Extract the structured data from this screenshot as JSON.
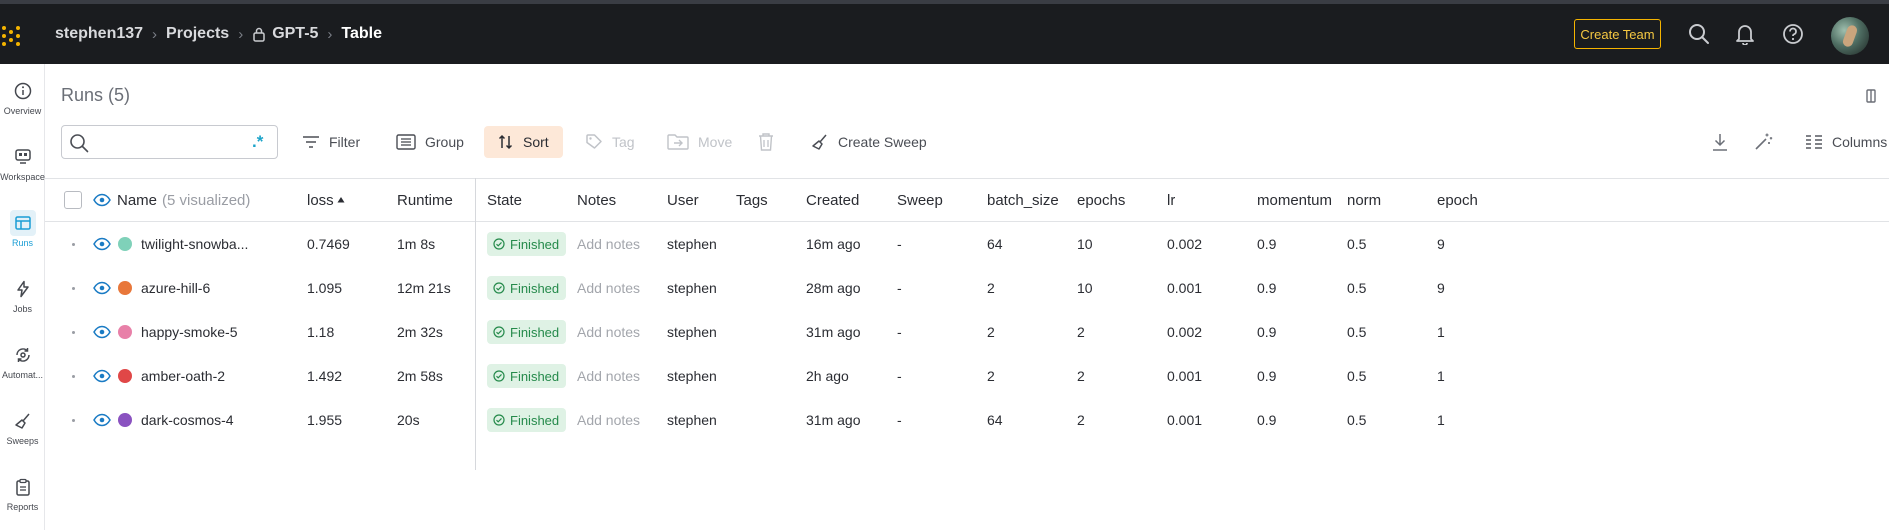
{
  "breadcrumb": {
    "user": "stephen137",
    "projects": "Projects",
    "project": "GPT-5",
    "current": "Table"
  },
  "header": {
    "create_team": "Create Team",
    "icons": [
      "search-icon",
      "bell-icon",
      "help-icon",
      "avatar"
    ]
  },
  "sidebar": {
    "items": [
      {
        "label": "Overview",
        "icon": "info-icon"
      },
      {
        "label": "Workspace",
        "icon": "workspace-icon"
      },
      {
        "label": "Runs",
        "icon": "table-icon",
        "active": true
      },
      {
        "label": "Jobs",
        "icon": "lightning-icon"
      },
      {
        "label": "Automat...",
        "icon": "automation-icon"
      },
      {
        "label": "Sweeps",
        "icon": "broom-icon"
      },
      {
        "label": "Reports",
        "icon": "clipboard-icon"
      }
    ]
  },
  "runs": {
    "title": "Runs (5)"
  },
  "search": {
    "placeholder": "",
    "regex_label": ".*"
  },
  "toolbar": {
    "filter": "Filter",
    "group": "Group",
    "sort": "Sort",
    "tag": "Tag",
    "move": "Move",
    "create_sweep": "Create Sweep",
    "columns": "Columns"
  },
  "table": {
    "headers": {
      "name": "Name",
      "name_sub": "(5 visualized)",
      "loss": "loss",
      "runtime": "Runtime",
      "state": "State",
      "notes": "Notes",
      "user": "User",
      "tags": "Tags",
      "created": "Created",
      "sweep": "Sweep",
      "batch_size": "batch_size",
      "epochs": "epochs",
      "lr": "lr",
      "momentum": "momentum",
      "norm": "norm",
      "epoch": "epoch"
    },
    "rows": [
      {
        "name": "twilight-snowba...",
        "color": "#7fd1b9",
        "loss": "0.7469",
        "runtime": "1m 8s",
        "state": "Finished",
        "notes": "Add notes",
        "user": "stephen",
        "created": "16m ago",
        "sweep": "-",
        "batch_size": "64",
        "epochs": "10",
        "lr": "0.002",
        "momentum": "0.9",
        "norm": "0.5",
        "epoch": "9"
      },
      {
        "name": "azure-hill-6",
        "color": "#e8773a",
        "loss": "1.095",
        "runtime": "12m 21s",
        "state": "Finished",
        "notes": "Add notes",
        "user": "stephen",
        "created": "28m ago",
        "sweep": "-",
        "batch_size": "2",
        "epochs": "10",
        "lr": "0.001",
        "momentum": "0.9",
        "norm": "0.5",
        "epoch": "9"
      },
      {
        "name": "happy-smoke-5",
        "color": "#e880a8",
        "loss": "1.18",
        "runtime": "2m 32s",
        "state": "Finished",
        "notes": "Add notes",
        "user": "stephen",
        "created": "31m ago",
        "sweep": "-",
        "batch_size": "2",
        "epochs": "2",
        "lr": "0.002",
        "momentum": "0.9",
        "norm": "0.5",
        "epoch": "1"
      },
      {
        "name": "amber-oath-2",
        "color": "#e04747",
        "loss": "1.492",
        "runtime": "2m 58s",
        "state": "Finished",
        "notes": "Add notes",
        "user": "stephen",
        "created": "2h ago",
        "sweep": "-",
        "batch_size": "2",
        "epochs": "2",
        "lr": "0.001",
        "momentum": "0.9",
        "norm": "0.5",
        "epoch": "1"
      },
      {
        "name": "dark-cosmos-4",
        "color": "#8a52c0",
        "loss": "1.955",
        "runtime": "20s",
        "state": "Finished",
        "notes": "Add notes",
        "user": "stephen",
        "created": "31m ago",
        "sweep": "-",
        "batch_size": "64",
        "epochs": "2",
        "lr": "0.001",
        "momentum": "0.9",
        "norm": "0.5",
        "epoch": "1"
      }
    ]
  },
  "colors": {
    "topbar_bg": "#1a1c1f",
    "accent_yellow": "#f5b400",
    "active_blue": "#1a9ed5",
    "sort_bg": "#fde8d8",
    "finished_bg": "#dff2e5",
    "finished_text": "#258a4b"
  }
}
